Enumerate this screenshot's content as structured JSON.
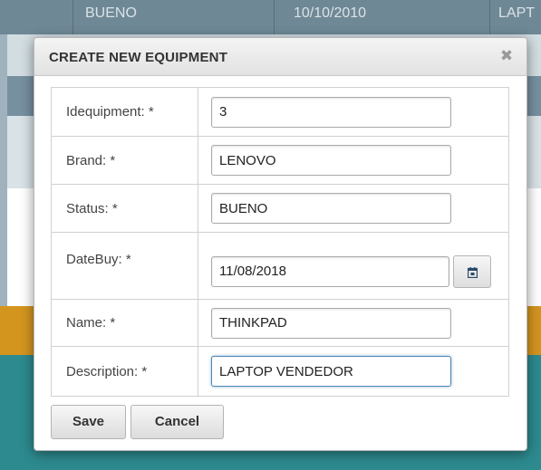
{
  "background_table": {
    "header_cells": [
      "BUENO",
      "10/10/2010",
      "LAPT"
    ]
  },
  "dialog": {
    "title": "CREATE NEW EQUIPMENT",
    "close_icon": "close-icon",
    "fields": [
      {
        "label": "Idequipment: *",
        "value": "3"
      },
      {
        "label": "Brand: *",
        "value": "LENOVO"
      },
      {
        "label": "Status: *",
        "value": "BUENO"
      },
      {
        "label": "DateBuy: *",
        "value": "11/08/2018"
      },
      {
        "label": "Name: *",
        "value": "THINKPAD"
      },
      {
        "label": "Description: *",
        "value": "LAPTOP VENDEDOR"
      }
    ],
    "calendar_icon": "calendar-icon",
    "buttons": {
      "save": "Save",
      "cancel": "Cancel"
    }
  },
  "colors": {
    "orange_row": "#d4951f",
    "teal_row": "#2d8a8f",
    "focus_border": "#4c87b4"
  }
}
